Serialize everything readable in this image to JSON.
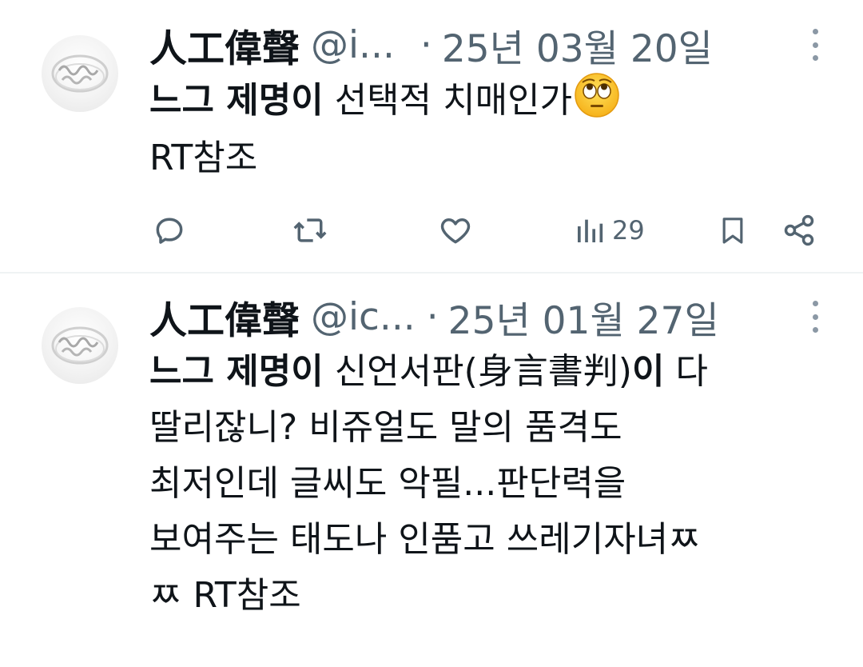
{
  "tweets": [
    {
      "author_name": "人工偉聲",
      "handle": "@i...",
      "separator": "·",
      "date": "25년 03월 20일",
      "body_bold": "느그 제명이",
      "body_text": " 선택적 치매인가",
      "emoji_name": "face-with-rolling-eyes",
      "body_line2": "RT참조",
      "views": "29",
      "icons": [
        "reply-icon",
        "retweet-icon",
        "like-icon",
        "views-icon",
        "bookmark-icon",
        "share-icon"
      ]
    },
    {
      "author_name": "人工偉聲",
      "handle": "@ic...",
      "separator": "·",
      "date": "25년 01월 27일",
      "body_bold": "느그 제명이",
      "body_part1": " 신언서판(身言書判)",
      "body_bold2": "이",
      "body_part2": " 다",
      "lines": [
        "딸리잖니? 비쥬얼도 말의 품격도",
        "최저인데 글씨도 악필...판단력을",
        "보여주는 태도나 인품고 쓰레기자녀ㅉ",
        "ㅉ RT참조"
      ]
    }
  ],
  "colors": {
    "text": "#0f1419",
    "muted": "#536471",
    "divider": "#eff3f4"
  }
}
